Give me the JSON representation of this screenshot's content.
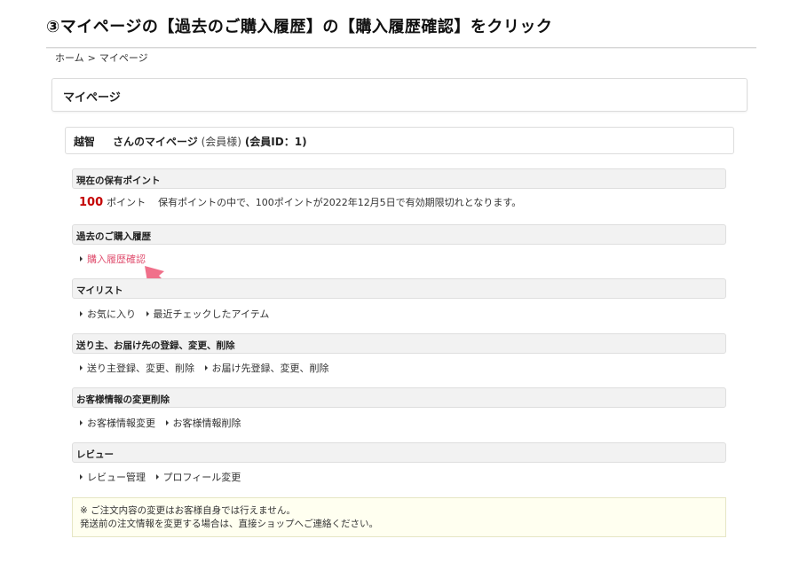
{
  "instruction": "③マイページの【過去のご購入履歴】の【購入履歴確認】をクリック",
  "breadcrumb": {
    "home": "ホーム",
    "separator": ">",
    "current": "マイページ"
  },
  "page_title": "マイページ",
  "user": {
    "name": "越智",
    "suffix": "さんのマイページ",
    "member_type": "(会員様)",
    "member_id": "(会員ID：1)"
  },
  "sections": {
    "points": {
      "heading": "現在の保有ポイント",
      "value": "100",
      "unit": "ポイント",
      "note": "保有ポイントの中で、100ポイントが2022年12月5日で有効期限切れとなります。"
    },
    "history": {
      "heading": "過去のご購入履歴",
      "links": [
        "購入履歴確認"
      ]
    },
    "mylist": {
      "heading": "マイリスト",
      "links": [
        "お気に入り",
        "最近チェックしたアイテム"
      ]
    },
    "address": {
      "heading": "送り主、お届け先の登録、変更、削除",
      "links": [
        "送り主登録、変更、削除",
        "お届け先登録、変更、削除"
      ]
    },
    "customer": {
      "heading": "お客様情報の変更削除",
      "links": [
        "お客様情報変更",
        "お客様情報削除"
      ]
    },
    "review": {
      "heading": "レビュー",
      "links": [
        "レビュー管理",
        "プロフィール変更"
      ]
    }
  },
  "notice": {
    "line1": "※ ご注文内容の変更はお客様自身では行えません。",
    "line2": "発送前の注文情報を変更する場合は、直接ショップへご連絡ください。"
  },
  "colors": {
    "highlight_link": "#e05070",
    "arrow": "#f0708a",
    "points": "#c40000",
    "notice_bg": "#fffff0"
  },
  "icons": {
    "arrow": "up-left-pointer-arrow-icon",
    "bullet": "right-triangle-bullet-icon"
  }
}
